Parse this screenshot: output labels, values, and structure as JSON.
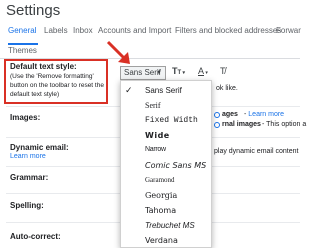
{
  "page_title": "Settings",
  "tabs": [
    {
      "label": "General",
      "active": true
    },
    {
      "label": "Labels",
      "active": false
    },
    {
      "label": "Inbox",
      "active": false
    },
    {
      "label": "Accounts and Import",
      "active": false
    },
    {
      "label": "Filters and blocked addresses",
      "active": false
    },
    {
      "label": "Forwar",
      "active": false
    },
    {
      "label": "Themes",
      "active": false
    }
  ],
  "default_text_style": {
    "title": "Default text style:",
    "description": "(Use the 'Remove formatting' button on the toolbar to reset the default text style)"
  },
  "toolbar": {
    "font_name": "Sans Serif",
    "font_dropdown_icon": "chevron-down-icon",
    "text_size_icon": "text-size-icon",
    "text_color_icon": "text-color-icon",
    "remove_format_icon": "remove-formatting-icon",
    "preview_text": "ok like."
  },
  "sections": [
    {
      "label": "Images:"
    },
    {
      "label": "Dynamic email:",
      "link": "Learn more"
    },
    {
      "label": "Grammar:"
    },
    {
      "label": "Spelling:"
    },
    {
      "label": "Auto-correct:"
    }
  ],
  "images_options": {
    "option1_bold": "ages",
    "option1_link": "Learn more",
    "option2_bold": "rnal images",
    "option2_text": "- This option a"
  },
  "dynamic_email_text": "play dynamic email content",
  "font_menu": {
    "items": [
      {
        "label": "Sans Serif",
        "selected": true
      },
      {
        "label": "Serif",
        "selected": false
      },
      {
        "label": "Fixed Width",
        "selected": false
      },
      {
        "label": "Wide",
        "selected": false
      },
      {
        "label": "Narrow",
        "selected": false
      },
      {
        "label": "Comic Sans MS",
        "selected": false
      },
      {
        "label": "Garamond",
        "selected": false
      },
      {
        "label": "Georgia",
        "selected": false
      },
      {
        "label": "Tahoma",
        "selected": false
      },
      {
        "label": "Trebuchet MS",
        "selected": false
      },
      {
        "label": "Verdana",
        "selected": false
      }
    ]
  },
  "colors": {
    "accent": "#1a73e8",
    "highlight": "#d93025"
  }
}
